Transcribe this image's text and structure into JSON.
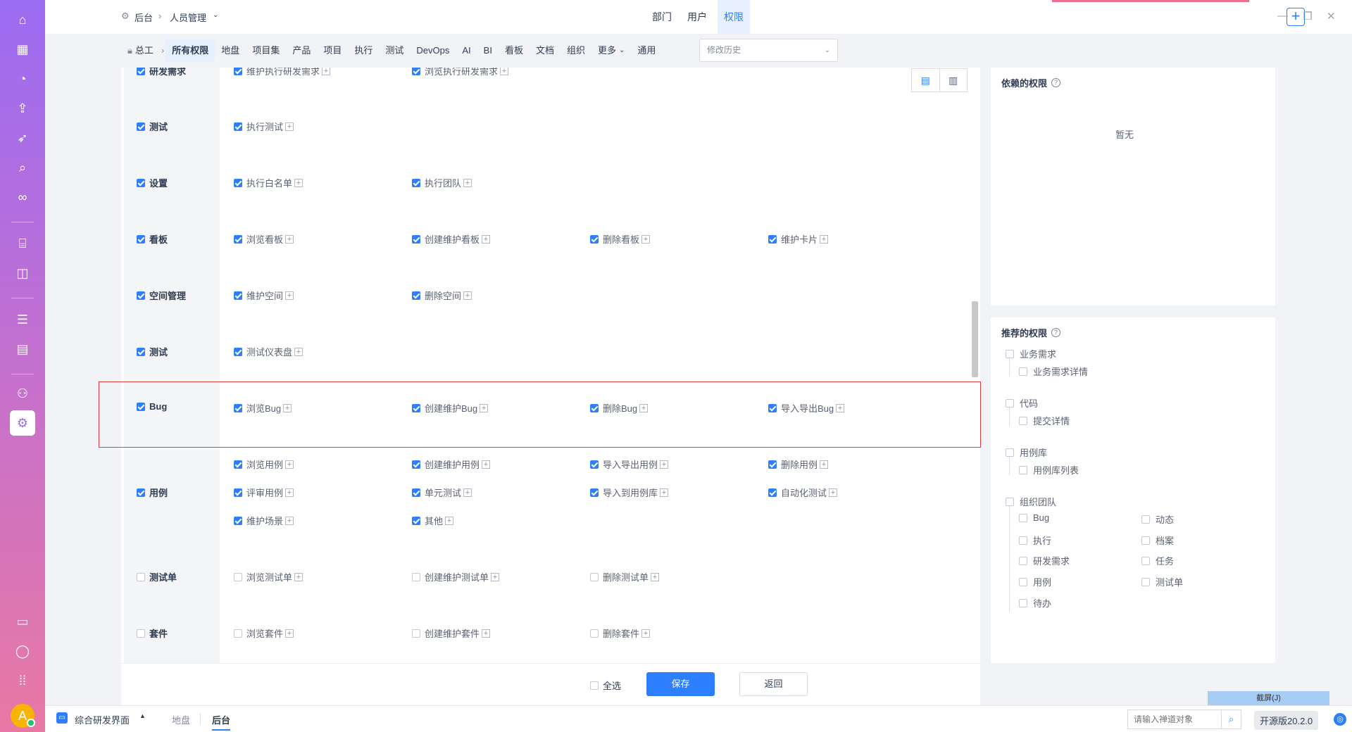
{
  "app": {
    "breadcrumb": {
      "root": "后台",
      "module": "人员管理"
    },
    "top_tabs": [
      "部门",
      "用户",
      "权限"
    ],
    "active_top_tab": "权限"
  },
  "subnav": {
    "group": "总工",
    "items": [
      "所有权限",
      "地盘",
      "项目集",
      "产品",
      "项目",
      "执行",
      "测试",
      "DevOps",
      "AI",
      "BI",
      "看板",
      "文档",
      "组织",
      "更多",
      "通用"
    ],
    "active": "所有权限",
    "history_select": "修改历史"
  },
  "permission_rows": [
    {
      "category": "研发需求",
      "checked": true,
      "perms": [
        {
          "label": "维护执行研发需求",
          "checked": true
        },
        {
          "label": "浏览执行研发需求",
          "checked": true
        }
      ]
    },
    {
      "category": "测试",
      "checked": true,
      "perms": [
        {
          "label": "执行测试",
          "checked": true
        }
      ]
    },
    {
      "category": "设置",
      "checked": true,
      "perms": [
        {
          "label": "执行白名单",
          "checked": true
        },
        {
          "label": "执行团队",
          "checked": true
        }
      ]
    },
    {
      "category": "看板",
      "checked": true,
      "perms": [
        {
          "label": "浏览看板",
          "checked": true
        },
        {
          "label": "创建维护看板",
          "checked": true
        },
        {
          "label": "删除看板",
          "checked": true
        },
        {
          "label": "维护卡片",
          "checked": true
        }
      ]
    },
    {
      "category": "空间管理",
      "checked": true,
      "perms": [
        {
          "label": "维护空间",
          "checked": true
        },
        {
          "label": "删除空间",
          "checked": true
        }
      ]
    },
    {
      "category": "测试",
      "checked": true,
      "perms": [
        {
          "label": "测试仪表盘",
          "checked": true
        }
      ]
    },
    {
      "category": "Bug",
      "checked": true,
      "perms": [
        {
          "label": "浏览Bug",
          "checked": true
        },
        {
          "label": "创建维护Bug",
          "checked": true
        },
        {
          "label": "删除Bug",
          "checked": true
        },
        {
          "label": "导入导出Bug",
          "checked": true
        }
      ]
    },
    {
      "category": "用例",
      "checked": true,
      "perms": [
        {
          "label": "浏览用例",
          "checked": true
        },
        {
          "label": "创建维护用例",
          "checked": true
        },
        {
          "label": "导入导出用例",
          "checked": true
        },
        {
          "label": "删除用例",
          "checked": true
        },
        {
          "label": "评审用例",
          "checked": true
        },
        {
          "label": "单元测试",
          "checked": true
        },
        {
          "label": "导入到用例库",
          "checked": true
        },
        {
          "label": "自动化测试",
          "checked": true
        },
        {
          "label": "维护场景",
          "checked": true
        },
        {
          "label": "其他",
          "checked": true
        }
      ]
    },
    {
      "category": "测试单",
      "checked": false,
      "perms": [
        {
          "label": "浏览测试单",
          "checked": false
        },
        {
          "label": "创建维护测试单",
          "checked": false
        },
        {
          "label": "删除测试单",
          "checked": false
        }
      ]
    },
    {
      "category": "套件",
      "checked": false,
      "perms": [
        {
          "label": "浏览套件",
          "checked": false
        },
        {
          "label": "创建维护套件",
          "checked": false
        },
        {
          "label": "删除套件",
          "checked": false
        }
      ]
    }
  ],
  "footer": {
    "select_all": "全选",
    "save": "保存",
    "back": "返回"
  },
  "dependent_panel": {
    "title": "依赖的权限",
    "empty": "暂无"
  },
  "recommended_panel": {
    "title": "推荐的权限",
    "groups": [
      {
        "label": "业务需求",
        "children": [
          "业务需求详情"
        ]
      },
      {
        "label": "代码",
        "children": [
          "提交详情"
        ]
      },
      {
        "label": "用例库",
        "children": [
          "用例库列表"
        ]
      },
      {
        "label": "组织团队",
        "children": [
          "Bug",
          "动态",
          "执行",
          "档案",
          "研发需求",
          "任务",
          "用例",
          "测试单",
          "待办"
        ]
      }
    ]
  },
  "bottom_bar": {
    "workspace": "综合研发界面",
    "tabs": [
      "地盘",
      "后台"
    ],
    "active_tab": "后台",
    "search_placeholder": "请输入禅道对象",
    "version": "开源版20.2.0",
    "screenshot": "截屏(J)"
  },
  "avatar_initial": "A",
  "colors": {
    "primary": "#2e7fff",
    "sidebar_top": "#9b6cf2",
    "sidebar_bottom": "#e979a4",
    "highlight_border": "#e23b3b"
  },
  "sidebar_icons": [
    "home-icon",
    "grid-icon",
    "bulb-icon",
    "rocket-icon",
    "sprint-icon",
    "search-bug-icon",
    "infinity-icon",
    "robot-icon",
    "chart-board-icon",
    "layers-icon",
    "doc-icon",
    "team-icon",
    "settings-icon",
    "chat-icon",
    "user-icon",
    "apps-icon"
  ]
}
